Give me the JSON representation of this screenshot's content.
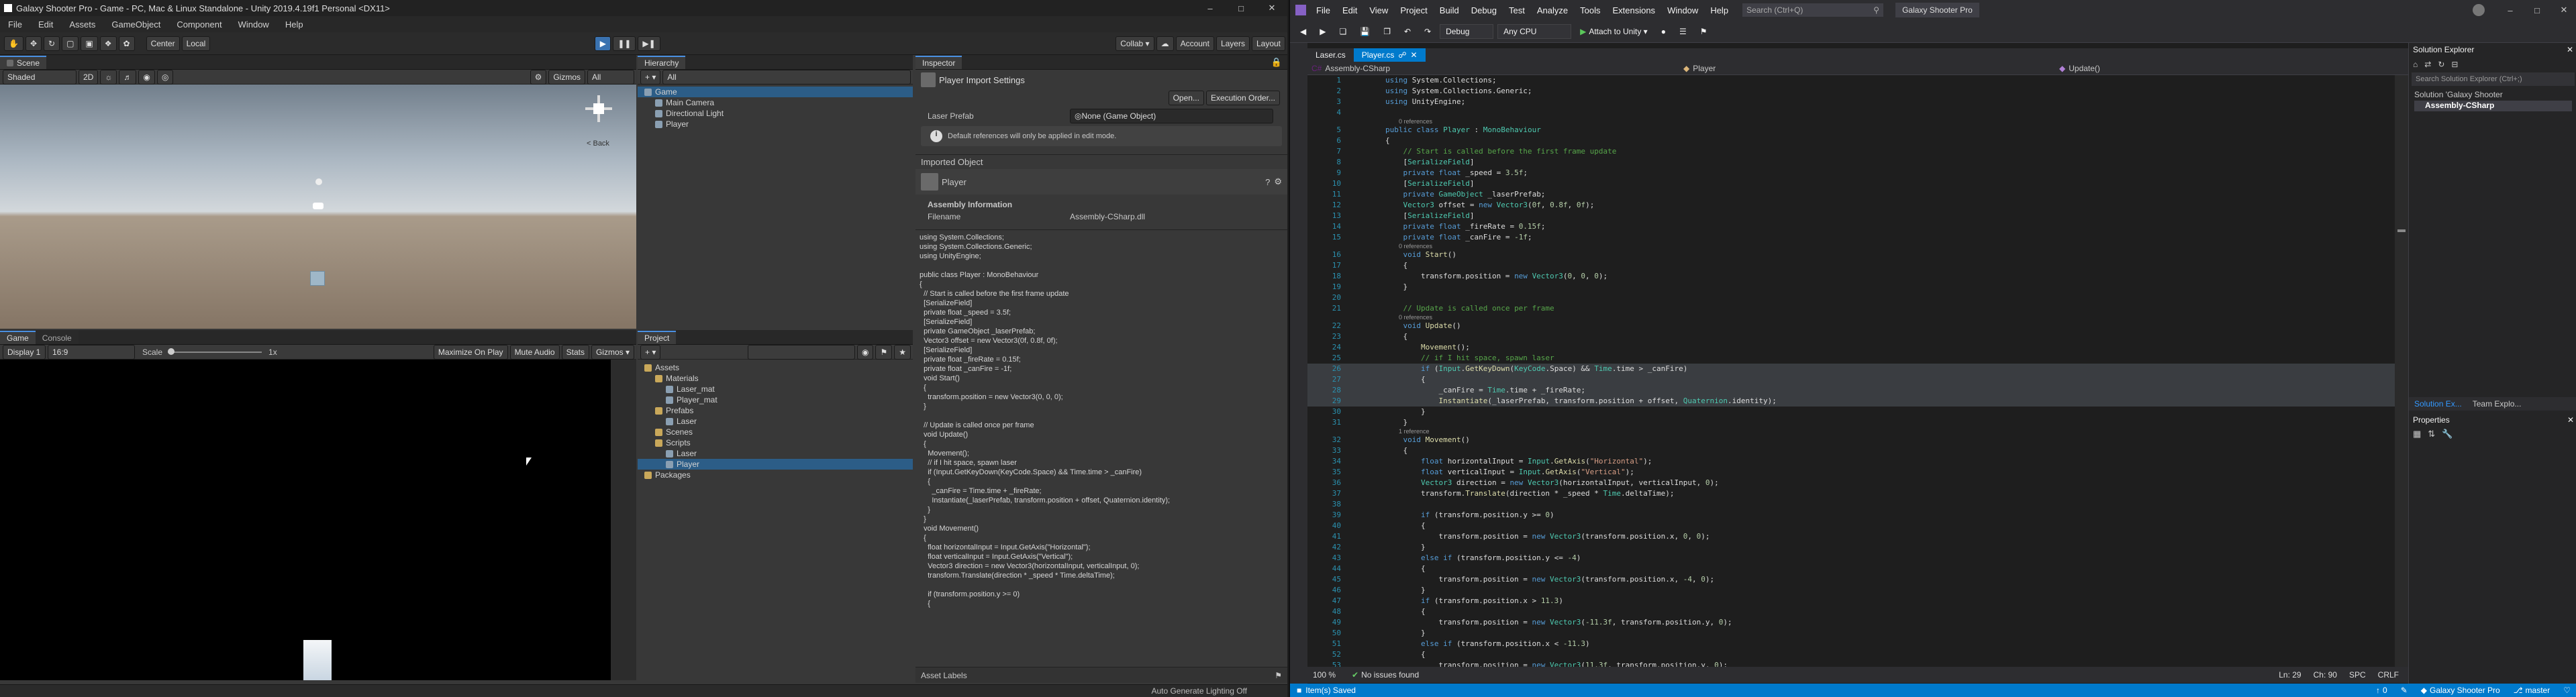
{
  "unity": {
    "title": "Galaxy Shooter Pro - Game - PC, Mac & Linux Standalone - Unity 2019.4.19f1 Personal <DX11>",
    "menu": [
      "File",
      "Edit",
      "Assets",
      "GameObject",
      "Component",
      "Window",
      "Help"
    ],
    "toolbar": {
      "center": "Center",
      "local": "Local",
      "collab": "Collab ▾",
      "account": "Account",
      "layers": "Layers",
      "layout": "Layout"
    },
    "scene": {
      "tabs": [
        "Scene"
      ],
      "shading": "Shaded",
      "mode2d": "2D",
      "gizmos": "Gizmos",
      "search": "All",
      "persp": "< Back"
    },
    "game": {
      "tabs": [
        "Game",
        "Console"
      ],
      "display": "Display 1",
      "aspect": "16:9",
      "scale_label": "Scale",
      "scale_value": "1x",
      "opts": [
        "Maximize On Play",
        "Mute Audio",
        "Stats",
        "Gizmos ▾"
      ]
    },
    "hierarchy": {
      "tab": "Hierarchy",
      "add": "+ ▾",
      "search": "All",
      "items": [
        {
          "label": "Game",
          "depth": 0,
          "sel": true
        },
        {
          "label": "Main Camera",
          "depth": 1
        },
        {
          "label": "Directional Light",
          "depth": 1
        },
        {
          "label": "Player",
          "depth": 1
        }
      ]
    },
    "project": {
      "tab": "Project",
      "add": "+ ▾",
      "items": [
        {
          "label": "Assets",
          "depth": 0,
          "folder": true
        },
        {
          "label": "Materials",
          "depth": 1,
          "folder": true
        },
        {
          "label": "Laser_mat",
          "depth": 2
        },
        {
          "label": "Player_mat",
          "depth": 2
        },
        {
          "label": "Prefabs",
          "depth": 1,
          "folder": true
        },
        {
          "label": "Laser",
          "depth": 2
        },
        {
          "label": "Scenes",
          "depth": 1,
          "folder": true
        },
        {
          "label": "Scripts",
          "depth": 1,
          "folder": true
        },
        {
          "label": "Laser",
          "depth": 2
        },
        {
          "label": "Player",
          "depth": 2,
          "sel": true
        },
        {
          "label": "Packages",
          "depth": 0,
          "folder": true
        }
      ]
    },
    "inspector": {
      "tab": "Inspector",
      "header": "Player Import Settings",
      "open": "Open...",
      "exec": "Execution Order...",
      "field_label": "Laser Prefab",
      "field_value": "None (Game Object)",
      "info": "Default references will only be applied in edit mode.",
      "imported": "Imported Object",
      "asset_name": "Player",
      "assembly_title": "Assembly Information",
      "filename_label": "Filename",
      "filename_value": "Assembly-CSharp.dll",
      "preview": "using System.Collections;\nusing System.Collections.Generic;\nusing UnityEngine;\n\npublic class Player : MonoBehaviour\n{\n  // Start is called before the first frame update\n  [SerializeField]\n  private float _speed = 3.5f;\n  [SerializeField]\n  private GameObject _laserPrefab;\n  Vector3 offset = new Vector3(0f, 0.8f, 0f);\n  [SerializeField]\n  private float _fireRate = 0.15f;\n  private float _canFire = -1f;\n  void Start()\n  {\n    transform.position = new Vector3(0, 0, 0);\n  }\n\n  // Update is called once per frame\n  void Update()\n  {\n    Movement();\n    // if I hit space, spawn laser\n    if (Input.GetKeyDown(KeyCode.Space) && Time.time > _canFire)\n    {\n      _canFire = Time.time + _fireRate;\n      Instantiate(_laserPrefab, transform.position + offset, Quaternion.identity);\n    }\n  }\n  void Movement()\n  {\n    float horizontalInput = Input.GetAxis(\"Horizontal\");\n    float verticalInput = Input.GetAxis(\"Vertical\");\n    Vector3 direction = new Vector3(horizontalInput, verticalInput, 0);\n    transform.Translate(direction * _speed * Time.deltaTime);\n\n    if (transform.position.y >= 0)\n    {",
      "asset_labels": "Asset Labels"
    },
    "status": "Auto Generate Lighting Off"
  },
  "vs": {
    "menu": [
      "File",
      "Edit",
      "View",
      "Project",
      "Build",
      "Debug",
      "Test",
      "Analyze",
      "Tools",
      "Extensions",
      "Window",
      "Help"
    ],
    "search": "Search (Ctrl+Q)",
    "solution_name": "Galaxy Shooter Pro",
    "toolbar": {
      "config": "Debug",
      "platform": "Any CPU",
      "attach": "Attach to Unity ▾"
    },
    "tabs": [
      {
        "label": "Laser.cs",
        "active": false
      },
      {
        "label": "Player.cs",
        "active": true
      }
    ],
    "nav": {
      "project": "Assembly-CSharp",
      "class": "Player",
      "member": "Update()"
    },
    "code": [
      {
        "n": "1",
        "h": "<span class='kw'>using</span> System.Collections;"
      },
      {
        "n": "2",
        "h": "<span class='kw'>using</span> System.Collections.Generic;"
      },
      {
        "n": "3",
        "h": "<span class='kw'>using</span> UnityEngine;"
      },
      {
        "n": "4",
        "h": ""
      },
      {
        "ref": "0 references"
      },
      {
        "n": "5",
        "h": "<span class='kw'>public class</span> <span class='ty'>Player</span> : <span class='ty'>MonoBehaviour</span>"
      },
      {
        "n": "6",
        "h": "{"
      },
      {
        "n": "7",
        "h": "    <span class='cm'>// Start is called before the first frame update</span>"
      },
      {
        "n": "8",
        "h": "    [<span class='at'>SerializeField</span>]"
      },
      {
        "n": "9",
        "h": "    <span class='kw'>private float</span> _speed = <span class='nu'>3.5f</span>;"
      },
      {
        "n": "10",
        "h": "    [<span class='at'>SerializeField</span>]"
      },
      {
        "n": "11",
        "h": "    <span class='kw'>private</span> <span class='ty'>GameObject</span> _laserPrefab;"
      },
      {
        "n": "12",
        "h": "    <span class='ty'>Vector3</span> offset = <span class='kw'>new</span> <span class='ty'>Vector3</span>(<span class='nu'>0f</span>, <span class='nu'>0.8f</span>, <span class='nu'>0f</span>);"
      },
      {
        "n": "13",
        "h": "    [<span class='at'>SerializeField</span>]"
      },
      {
        "n": "14",
        "h": "    <span class='kw'>private float</span> _fireRate = <span class='nu'>0.15f</span>;"
      },
      {
        "n": "15",
        "h": "    <span class='kw'>private float</span> _canFire = <span class='nu'>-1f</span>;"
      },
      {
        "ref": "0 references"
      },
      {
        "n": "16",
        "h": "    <span class='kw'>void</span> <span class='mt'>Start</span>()"
      },
      {
        "n": "17",
        "h": "    {"
      },
      {
        "n": "18",
        "h": "        transform.position = <span class='kw'>new</span> <span class='ty'>Vector3</span>(<span class='nu'>0</span>, <span class='nu'>0</span>, <span class='nu'>0</span>);"
      },
      {
        "n": "19",
        "h": "    }"
      },
      {
        "n": "20",
        "h": ""
      },
      {
        "n": "21",
        "h": "    <span class='cm'>// Update is called once per frame</span>"
      },
      {
        "ref": "0 references"
      },
      {
        "n": "22",
        "h": "    <span class='kw'>void</span> <span class='mt'>Update</span>()"
      },
      {
        "n": "23",
        "h": "    {"
      },
      {
        "n": "24",
        "h": "        <span class='mt'>Movement</span>();"
      },
      {
        "n": "25",
        "h": "        <span class='cm'>// if I hit space, spawn laser</span>"
      },
      {
        "n": "26",
        "h": "        <span class='kw'>if</span> (<span class='ty'>Input</span>.<span class='mt'>GetKeyDown</span>(<span class='ty'>KeyCode</span>.Space) &amp;&amp; <span class='ty'>Time</span>.time &gt; _canFire)",
        "hl": true
      },
      {
        "n": "27",
        "h": "        {",
        "hl": true
      },
      {
        "n": "28",
        "h": "            _canFire = <span class='ty'>Time</span>.time + _fireRate;",
        "hl": true
      },
      {
        "n": "29",
        "h": "            <span class='mt'>Instantiate</span>(_laserPrefab, transform.position + offset, <span class='ty'>Quaternion</span>.identity);",
        "hl": true
      },
      {
        "n": "30",
        "h": "        }"
      },
      {
        "n": "31",
        "h": "    }"
      },
      {
        "ref": "1 reference"
      },
      {
        "n": "32",
        "h": "    <span class='kw'>void</span> <span class='mt'>Movement</span>()"
      },
      {
        "n": "33",
        "h": "    {"
      },
      {
        "n": "34",
        "h": "        <span class='kw'>float</span> horizontalInput = <span class='ty'>Input</span>.<span class='mt'>GetAxis</span>(<span style='color:#d69d85'>\"Horizontal\"</span>);"
      },
      {
        "n": "35",
        "h": "        <span class='kw'>float</span> verticalInput = <span class='ty'>Input</span>.<span class='mt'>GetAxis</span>(<span style='color:#d69d85'>\"Vertical\"</span>);"
      },
      {
        "n": "36",
        "h": "        <span class='ty'>Vector3</span> direction = <span class='kw'>new</span> <span class='ty'>Vector3</span>(horizontalInput, verticalInput, <span class='nu'>0</span>);"
      },
      {
        "n": "37",
        "h": "        transform.<span class='mt'>Translate</span>(direction * _speed * <span class='ty'>Time</span>.deltaTime);"
      },
      {
        "n": "38",
        "h": ""
      },
      {
        "n": "39",
        "h": "        <span class='kw'>if</span> (transform.position.y &gt;= <span class='nu'>0</span>)"
      },
      {
        "n": "40",
        "h": "        {"
      },
      {
        "n": "41",
        "h": "            transform.position = <span class='kw'>new</span> <span class='ty'>Vector3</span>(transform.position.x, <span class='nu'>0</span>, <span class='nu'>0</span>);"
      },
      {
        "n": "42",
        "h": "        }"
      },
      {
        "n": "43",
        "h": "        <span class='kw'>else if</span> (transform.position.y &lt;= <span class='nu'>-4</span>)"
      },
      {
        "n": "44",
        "h": "        {"
      },
      {
        "n": "45",
        "h": "            transform.position = <span class='kw'>new</span> <span class='ty'>Vector3</span>(transform.position.x, <span class='nu'>-4</span>, <span class='nu'>0</span>);"
      },
      {
        "n": "46",
        "h": "        }"
      },
      {
        "n": "47",
        "h": "        <span class='kw'>if</span> (transform.position.x &gt; <span class='nu'>11.3</span>)"
      },
      {
        "n": "48",
        "h": "        {"
      },
      {
        "n": "49",
        "h": "            transform.position = <span class='kw'>new</span> <span class='ty'>Vector3</span>(<span class='nu'>-11.3f</span>, transform.position.y, <span class='nu'>0</span>);"
      },
      {
        "n": "50",
        "h": "        }"
      },
      {
        "n": "51",
        "h": "        <span class='kw'>else if</span> (transform.position.x &lt; <span class='nu'>-11.3</span>)"
      },
      {
        "n": "52",
        "h": "        {"
      },
      {
        "n": "53",
        "h": "            transform.position = <span class='kw'>new</span> <span class='ty'>Vector3</span>(<span class='nu'>11.3f</span>, transform.position.y, <span class='nu'>0</span>);"
      }
    ],
    "editor_bottom": {
      "zoom": "100 %",
      "issues": "No issues found",
      "pos": "Ln: 29",
      "col": "Ch: 90",
      "spc": "SPC",
      "crlf": "CRLF"
    },
    "solution_explorer": {
      "title": "Solution Explorer",
      "search": "Search Solution Explorer (Ctrl+;)",
      "solution": "Solution 'Galaxy Shooter",
      "project": "Assembly-CSharp",
      "tab1": "Solution Ex...",
      "tab2": "Team Explo..."
    },
    "properties_title": "Properties",
    "status": {
      "left": "Item(s) Saved",
      "errors": "0",
      "branch": "master",
      "repo": "Galaxy Shooter Pro"
    }
  }
}
